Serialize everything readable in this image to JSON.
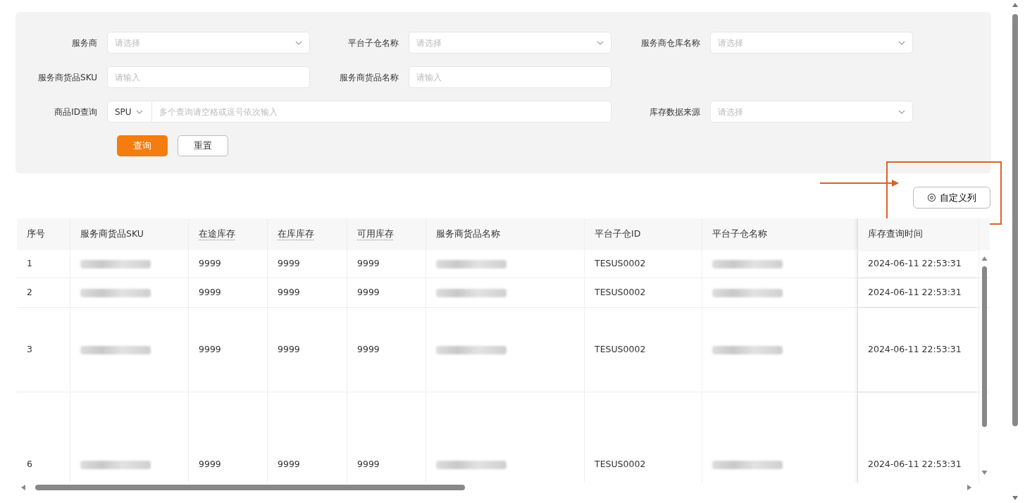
{
  "filters": [
    {
      "kind": "select",
      "label": "服务商",
      "placeholder": "请选择"
    },
    {
      "kind": "select",
      "label": "平台子仓名称",
      "placeholder": "请选择"
    },
    {
      "kind": "select",
      "label": "服务商仓库名称",
      "placeholder": "请选择"
    },
    {
      "kind": "input",
      "label": "服务商货品SKU",
      "placeholder": "请输入"
    },
    {
      "kind": "input",
      "label": "服务商货品名称",
      "placeholder": "请输入"
    },
    {
      "kind": "combo",
      "label": "商品ID查询",
      "prefix": "SPU",
      "placeholder": "多个查询请空格或逗号依次输入"
    },
    {
      "kind": "select",
      "label": "库存数据来源",
      "placeholder": "请选择"
    }
  ],
  "buttons": [
    {
      "label": "查询",
      "kind": "primary"
    },
    {
      "label": "重置",
      "kind": "default"
    }
  ],
  "customize_button": {
    "label": "自定义列"
  },
  "table": {
    "columns": [
      {
        "label": "序号",
        "hint": false
      },
      {
        "label": "服务商货品SKU",
        "hint": false
      },
      {
        "label": "在途库存",
        "hint": true
      },
      {
        "label": "在库库存",
        "hint": true
      },
      {
        "label": "可用库存",
        "hint": true
      },
      {
        "label": "服务商货品名称",
        "hint": false
      },
      {
        "label": "平台子仓ID",
        "hint": false
      },
      {
        "label": "平台子仓名称",
        "hint": false
      },
      {
        "label": "库存查询时间",
        "hint": false
      }
    ],
    "rows": [
      {
        "cells": [
          {
            "text": "1"
          },
          {
            "blurred": true
          },
          {
            "text": "9999"
          },
          {
            "text": "9999"
          },
          {
            "text": "9999"
          },
          {
            "blurred": true
          },
          {
            "text": "TESUS0002"
          },
          {
            "blurred": true
          },
          {
            "text": "2024-06-11 22:53:31"
          }
        ]
      },
      {
        "cells": [
          {
            "text": "2"
          },
          {
            "blurred": true
          },
          {
            "text": "9999"
          },
          {
            "text": "9999"
          },
          {
            "text": "9999"
          },
          {
            "blurred": true
          },
          {
            "text": "TESUS0002"
          },
          {
            "blurred": true
          },
          {
            "text": "2024-06-11 22:53:31"
          }
        ]
      },
      {
        "cells": [
          {
            "text": "3"
          },
          {
            "blurred": true
          },
          {
            "text": "9999"
          },
          {
            "text": "9999"
          },
          {
            "text": "9999"
          },
          {
            "blurred": true
          },
          {
            "text": "TESUS0002"
          },
          {
            "blurred": true
          },
          {
            "text": "2024-06-11 22:53:31"
          }
        ]
      },
      {
        "cells": [
          {
            "text": "6"
          },
          {
            "blurred": true
          },
          {
            "text": "9999"
          },
          {
            "text": "9999"
          },
          {
            "text": "9999"
          },
          {
            "blurred": true
          },
          {
            "text": "TESUS0002"
          },
          {
            "blurred": true
          },
          {
            "text": "2024-06-11 22:53:31"
          }
        ]
      }
    ]
  }
}
